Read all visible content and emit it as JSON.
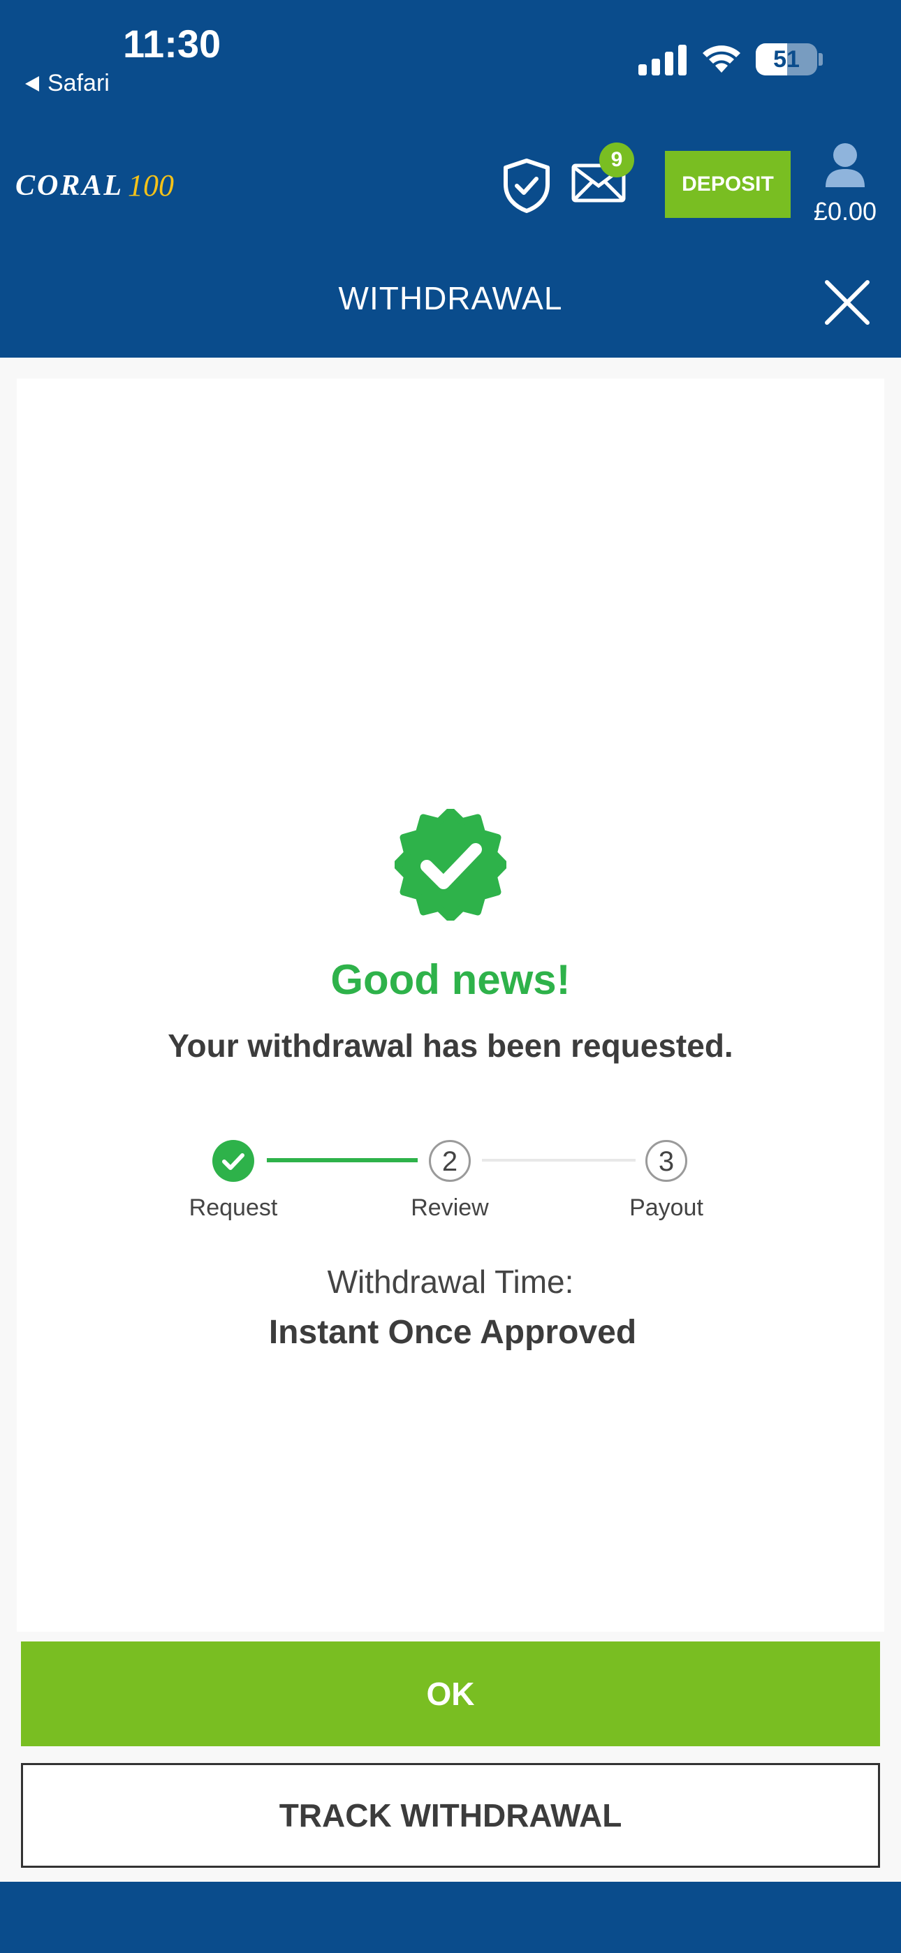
{
  "status_bar": {
    "time": "11:30",
    "back_app": "Safari",
    "battery_level": "51",
    "battery_fraction": 0.51
  },
  "header": {
    "logo_text": "CORAL",
    "logo_badge": "100",
    "messages_count": "9",
    "deposit_label": "DEPOSIT",
    "balance": "£0.00",
    "title": "WITHDRAWAL",
    "icons": [
      "shield-check-icon",
      "mail-icon",
      "user-icon",
      "close-icon"
    ]
  },
  "confirmation": {
    "icon": "verified-check-badge-icon",
    "headline": "Good news!",
    "message": "Your withdrawal has been requested.",
    "steps": [
      {
        "number": "1",
        "label": "Request",
        "state": "done"
      },
      {
        "number": "2",
        "label": "Review",
        "state": "pending"
      },
      {
        "number": "3",
        "label": "Payout",
        "state": "pending"
      }
    ],
    "withdrawal_time_label": "Withdrawal Time:",
    "withdrawal_time_value": "Instant Once Approved"
  },
  "actions": {
    "ok_label": "OK",
    "track_label": "TRACK WITHDRAWAL"
  },
  "colors": {
    "brand_blue": "#0a4c8c",
    "accent_green": "#79be22",
    "success_green": "#2eb24a"
  }
}
